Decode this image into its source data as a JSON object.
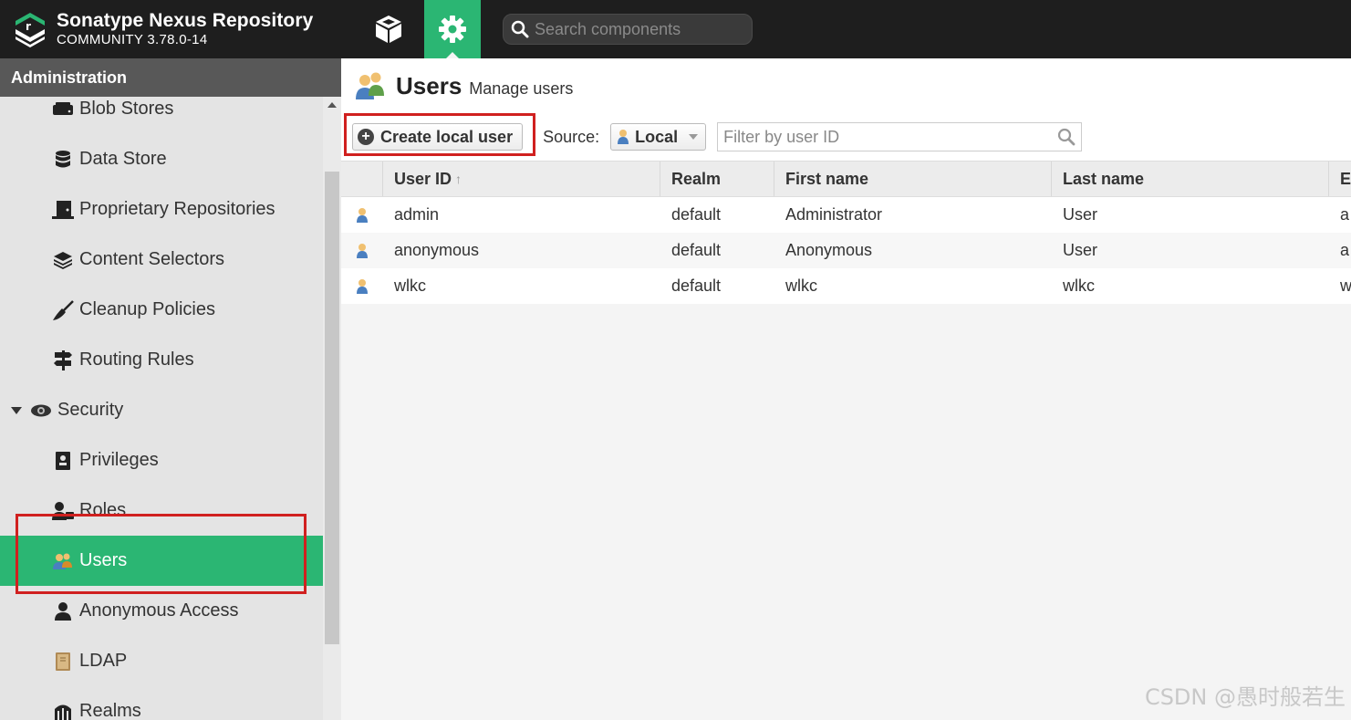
{
  "app": {
    "title": "Sonatype Nexus Repository",
    "edition": "COMMUNITY 3.78.0-14",
    "search_placeholder": "Search components"
  },
  "sidebar": {
    "header": "Administration",
    "items": [
      {
        "label": "Blob Stores",
        "icon": "blob-store-icon"
      },
      {
        "label": "Data Store",
        "icon": "database-icon"
      },
      {
        "label": "Proprietary Repositories",
        "icon": "proprietary-icon"
      },
      {
        "label": "Content Selectors",
        "icon": "layers-icon"
      },
      {
        "label": "Cleanup Policies",
        "icon": "broom-icon"
      },
      {
        "label": "Routing Rules",
        "icon": "signpost-icon"
      },
      {
        "label": "Security",
        "icon": "eye-icon"
      },
      {
        "label": "Privileges",
        "icon": "badge-icon"
      },
      {
        "label": "Roles",
        "icon": "user-role-icon"
      },
      {
        "label": "Users",
        "icon": "users-icon"
      },
      {
        "label": "Anonymous Access",
        "icon": "user-icon"
      },
      {
        "label": "LDAP",
        "icon": "book-icon"
      },
      {
        "label": "Realms",
        "icon": "realms-icon"
      }
    ],
    "active": "Users"
  },
  "main": {
    "title": "Users",
    "subtitle": "Manage users",
    "toolbar": {
      "create_label": "Create local user",
      "source_label": "Source:",
      "source_value": "Local",
      "filter_placeholder": "Filter by user ID"
    },
    "table": {
      "columns": [
        "User ID",
        "Realm",
        "First name",
        "Last name",
        "E"
      ],
      "rows": [
        [
          "admin",
          "default",
          "Administrator",
          "User",
          "a"
        ],
        [
          "anonymous",
          "default",
          "Anonymous",
          "User",
          "a"
        ],
        [
          "wlkc",
          "default",
          "wlkc",
          "wlkc",
          "w"
        ]
      ]
    }
  },
  "watermark": "CSDN @愚时般若生",
  "colors": {
    "topbar": "#1e1e1e",
    "accent": "#2bb673",
    "highlight": "#d0201f"
  }
}
